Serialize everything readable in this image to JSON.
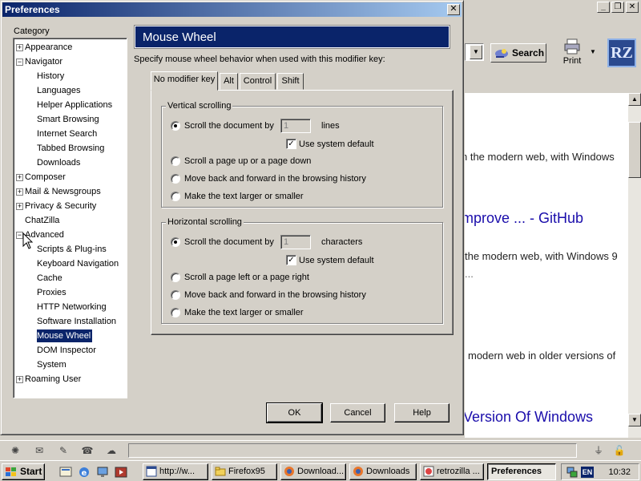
{
  "dialog": {
    "title": "Preferences",
    "close_glyph": "✕",
    "category_label": "Category",
    "categories": [
      {
        "label": "Appearance",
        "twisty": "+"
      },
      {
        "label": "Navigator",
        "twisty": "−"
      },
      {
        "label": "History"
      },
      {
        "label": "Languages"
      },
      {
        "label": "Helper Applications"
      },
      {
        "label": "Smart Browsing"
      },
      {
        "label": "Internet Search"
      },
      {
        "label": "Tabbed Browsing"
      },
      {
        "label": "Downloads"
      },
      {
        "label": "Composer",
        "twisty": "+"
      },
      {
        "label": "Mail & Newsgroups",
        "twisty": "+"
      },
      {
        "label": "Privacy & Security",
        "twisty": "+"
      },
      {
        "label": "ChatZilla"
      },
      {
        "label": "Advanced",
        "twisty": "−"
      },
      {
        "label": "Scripts & Plug-ins"
      },
      {
        "label": "Keyboard Navigation"
      },
      {
        "label": "Cache"
      },
      {
        "label": "Proxies"
      },
      {
        "label": "HTTP Networking"
      },
      {
        "label": "Software Installation"
      },
      {
        "label": "Mouse Wheel",
        "selected": true
      },
      {
        "label": "DOM Inspector"
      },
      {
        "label": "System"
      },
      {
        "label": "Roaming User",
        "twisty": "+"
      }
    ],
    "panel_title": "Mouse Wheel",
    "description": "Specify mouse wheel behavior when used with this modifier key:",
    "tabs": [
      "No modifier key",
      "Alt",
      "Control",
      "Shift"
    ],
    "active_tab": "No modifier key",
    "vertical": {
      "title": "Vertical scrolling",
      "scroll_label": "Scroll the document by",
      "scroll_value": "1",
      "scroll_unit": "lines",
      "use_default_label": "Use system default",
      "use_default_checked": true,
      "options": [
        "Scroll a page up or a page down",
        "Move back and forward in the browsing history",
        "Make the text larger or smaller"
      ]
    },
    "horizontal": {
      "title": "Horizontal scrolling",
      "scroll_label": "Scroll the document by",
      "scroll_value": "1",
      "scroll_unit": "characters",
      "use_default_label": "Use system default",
      "use_default_checked": true,
      "options": [
        "Scroll a page left or a page right",
        "Move back and forward in the browsing history",
        "Make the text larger or smaller"
      ]
    },
    "buttons": {
      "ok": "OK",
      "cancel": "Cancel",
      "help": "Help"
    }
  },
  "browser": {
    "search_label": "Search",
    "print_label": "Print",
    "logo_text": "RZ",
    "content_lines": [
      "n the modern web, with Windows",
      "mprove ... - GitHub",
      "the modern web, with Windows 9",
      "...",
      "modern web in older versions of",
      "Version Of Windows"
    ]
  },
  "taskbar": {
    "start_label": "Start",
    "tasks": [
      "http://w...",
      "Firefox95",
      "Download...",
      "Downloads",
      "retrozilla ...",
      "Preferences"
    ],
    "active_task": "Preferences",
    "lang": "EN",
    "clock": "10:32"
  },
  "colors": {
    "titlebar": "#0a246a",
    "face": "#d4d0c8",
    "selection": "#0a246a",
    "link": "#1a0dab"
  }
}
